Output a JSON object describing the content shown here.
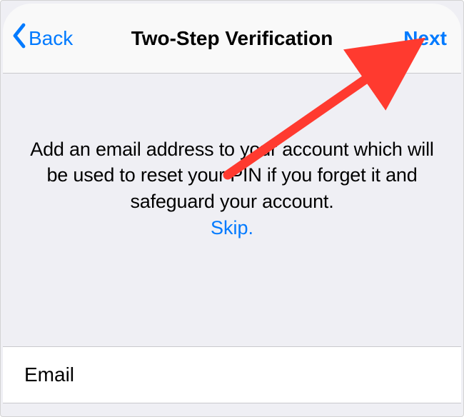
{
  "nav": {
    "back_label": "Back",
    "title": "Two-Step Verification",
    "next_label": "Next"
  },
  "body": {
    "description": "Add an email address to your account which will be used to reset your PIN if you forget it and safeguard your account.",
    "skip_label": "Skip."
  },
  "field": {
    "placeholder": "Email"
  },
  "colors": {
    "accent": "#007aff",
    "annotation": "#ff3a2f"
  }
}
